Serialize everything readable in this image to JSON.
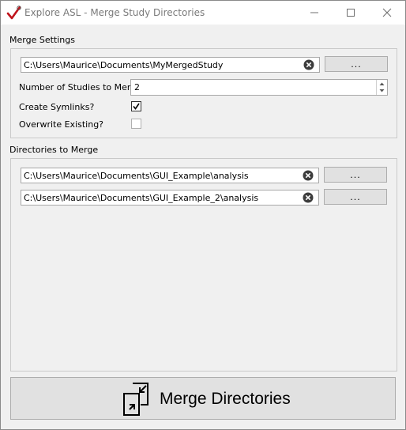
{
  "window": {
    "title": "Explore ASL - Merge Study Directories",
    "icon": "red-check-icon",
    "controls": [
      "minimize-icon",
      "maximize-icon",
      "close-icon"
    ]
  },
  "merge_settings": {
    "label": "Merge Settings",
    "output_path": "C:\\Users\\Maurice\\Documents\\MyMergedStudy",
    "browse_label": "...",
    "num_studies_label": "Number of Studies to Merge",
    "num_studies_value": "2",
    "symlinks_label": "Create Symlinks?",
    "symlinks_checked": true,
    "overwrite_label": "Overwrite Existing?",
    "overwrite_checked": false
  },
  "directories": {
    "label": "Directories to Merge",
    "items": [
      {
        "path": "C:\\Users\\Maurice\\Documents\\GUI_Example\\analysis",
        "browse_label": "..."
      },
      {
        "path": "C:\\Users\\Maurice\\Documents\\GUI_Example_2\\analysis",
        "browse_label": "..."
      }
    ]
  },
  "action": {
    "merge_label": "Merge Directories",
    "icon": "merge-icon"
  }
}
